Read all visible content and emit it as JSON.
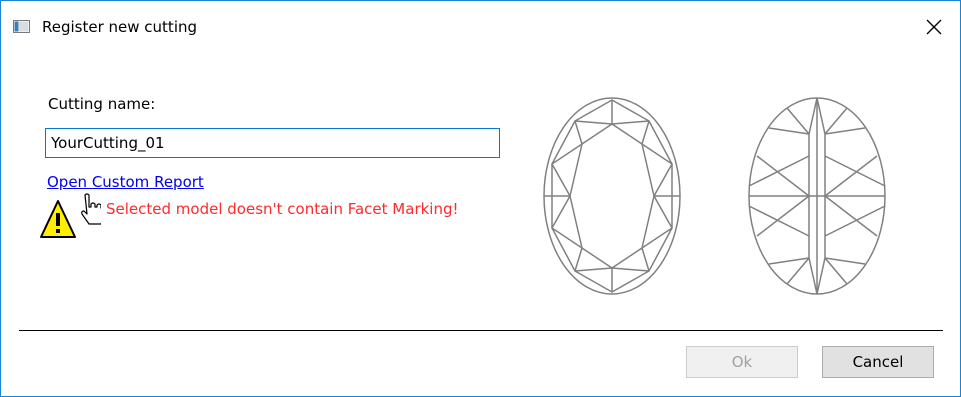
{
  "window": {
    "title": "Register new cutting",
    "icon": "app-icon",
    "close_icon": "close-icon",
    "border_color": "#1883d7"
  },
  "form": {
    "name_label": "Cutting name:",
    "name_value": "YourCutting_01",
    "report_link": "Open Custom Report",
    "warning_icon": "warning-triangle-icon",
    "warning_text": "Selected model doesn't contain Facet Marking!",
    "warning_color": "#ff2a2a",
    "link_color": "#0000ee"
  },
  "buttons": {
    "ok_label": "Ok",
    "ok_enabled": false,
    "cancel_label": "Cancel"
  },
  "gem_views": [
    {
      "name": "oval-crown-view",
      "shape": "oval"
    },
    {
      "name": "oval-pavilion-view",
      "shape": "oval"
    }
  ]
}
